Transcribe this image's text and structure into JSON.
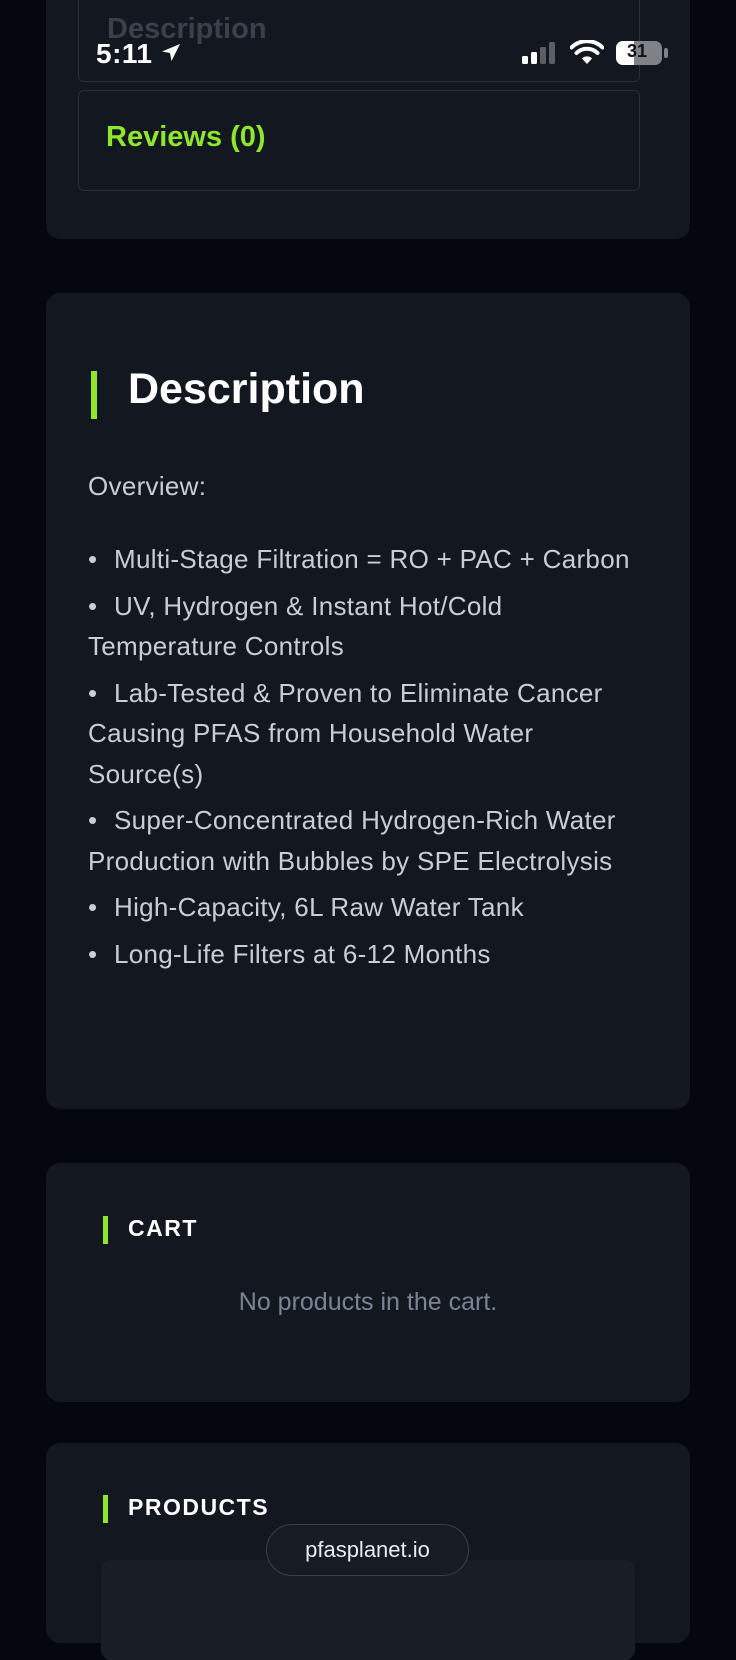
{
  "status_bar": {
    "time": "5:11",
    "battery": "31",
    "icons": [
      "location-arrow-icon",
      "signal-icon",
      "wifi-icon",
      "battery-icon"
    ]
  },
  "tabs": {
    "description_label": "Description",
    "reviews_label": "Reviews (0)"
  },
  "description": {
    "title": "Description",
    "overview_label": "Overview:",
    "features": [
      "Multi-Stage Filtration = RO + PAC + Carbon",
      "UV, Hydrogen & Instant Hot/Cold Temperature Controls",
      "Lab-Tested & Proven to Eliminate Cancer Causing PFAS from Household Water Source(s)",
      "Super-Concentrated Hydrogen-Rich Water Production with Bubbles by SPE Electrolysis",
      "High-Capacity, 6L Raw Water Tank",
      "Long-Life Filters at 6-12 Months"
    ]
  },
  "cart": {
    "title": "CART",
    "empty_message": "No products in the cart."
  },
  "products": {
    "title": "PRODUCTS"
  },
  "browser": {
    "url": "pfasplanet.io"
  },
  "colors": {
    "accent": "#8fe62b",
    "background": "#04070d",
    "card": "#121720"
  }
}
